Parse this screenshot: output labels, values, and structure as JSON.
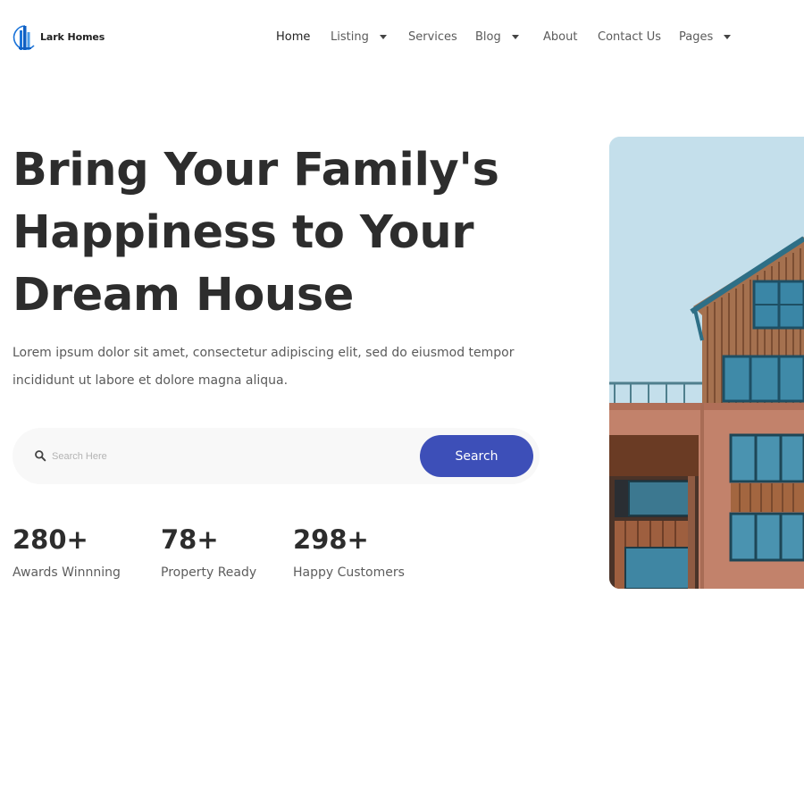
{
  "brand": {
    "name": "Lark Homes",
    "logo_icon": "building-logo-icon",
    "accent": "#1a73d9"
  },
  "nav": {
    "items": [
      {
        "label": "Home",
        "active": true,
        "has_dropdown": false
      },
      {
        "label": "Listing",
        "active": false,
        "has_dropdown": true
      },
      {
        "label": "Services",
        "active": false,
        "has_dropdown": false
      },
      {
        "label": "Blog",
        "active": false,
        "has_dropdown": true
      },
      {
        "label": "About",
        "active": false,
        "has_dropdown": false
      },
      {
        "label": "Contact Us",
        "active": false,
        "has_dropdown": false
      },
      {
        "label": "Pages",
        "active": false,
        "has_dropdown": true
      }
    ]
  },
  "hero": {
    "title_lines": [
      "Bring Your Family's",
      "Happiness to Your",
      "Dream House"
    ],
    "description_lines": [
      "Lorem ipsum dolor sit amet, consectetur adipiscing elit, sed do eiusmod tempor",
      "incididunt ut labore et dolore magna aliqua."
    ]
  },
  "search": {
    "placeholder": "Search Here",
    "value": "",
    "button_label": "Search",
    "button_color": "#3d4fb8",
    "icon": "search-icon"
  },
  "stats": [
    {
      "value": "280+",
      "label": "Awards Winnning"
    },
    {
      "value": "78+",
      "label": "Property Ready"
    },
    {
      "value": "298+",
      "label": "Happy Customers"
    }
  ],
  "image": {
    "subject": "modern-building-photo"
  }
}
